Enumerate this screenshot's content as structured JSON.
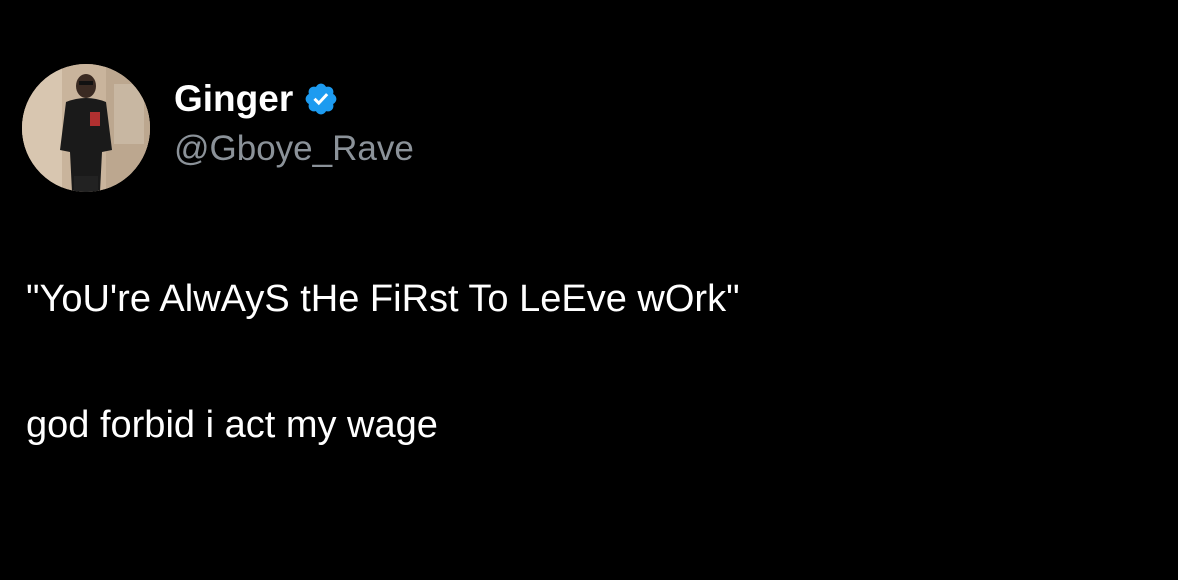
{
  "tweet": {
    "author": {
      "display_name": "Ginger",
      "handle": "@Gboye_Rave",
      "verified_icon": "verified-badge-icon",
      "avatar": "avatar"
    },
    "text_lines": [
      "\"YoU're AlwAyS tHe FiRst To LeEve wOrk\"",
      "god forbid i act my wage"
    ]
  },
  "colors": {
    "background": "#000000",
    "text": "#ffffff",
    "handle": "#8b9299",
    "verified": "#1d9bf0"
  }
}
